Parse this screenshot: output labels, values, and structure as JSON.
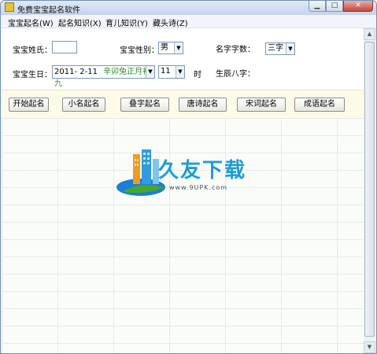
{
  "window": {
    "title": "免费宝宝起名软件"
  },
  "menu": [
    "宝宝起名(W)",
    "起名知识(X)",
    "育儿知识(Y)",
    "藏头诗(Z)"
  ],
  "form": {
    "surname_label": "宝宝姓氏：",
    "surname_value": "",
    "gender_label": "宝宝性别：",
    "gender_value": "男",
    "name_count_label": "名字字数：",
    "name_count_value": "三字",
    "birthday_label": "宝宝生日：",
    "birthday_date": "2011- 2-11",
    "birthday_lunar": "辛卯兔正月初九",
    "hour_value": "11",
    "hour_unit": "时",
    "bazi_label": "生辰八字："
  },
  "buttons": [
    "开始起名",
    "小名起名",
    "叠字起名",
    "唐诗起名",
    "宋词起名",
    "成语起名"
  ],
  "logo": {
    "text": "久友下载",
    "url": "www.9UPK.com"
  },
  "colors": {
    "lunar_text": "#2f8f2f",
    "logo_blue": "#1c9cd6",
    "button_bar": "#fbfbe8"
  }
}
